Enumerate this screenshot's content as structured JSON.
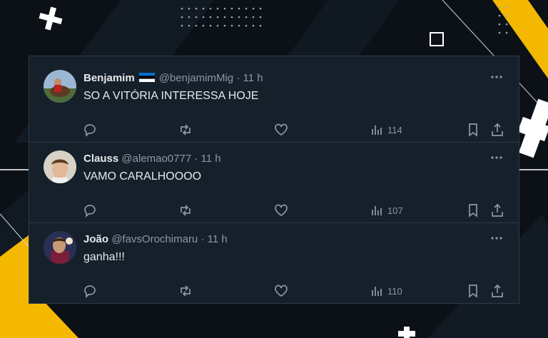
{
  "colors": {
    "panel_bg": "#15202b",
    "divider": "#2f3a46",
    "text": "#e7e9ea",
    "muted": "#8b98a5",
    "accent": "#f5b800"
  },
  "icons": [
    "reply-icon",
    "retweet-icon",
    "like-icon",
    "views-icon",
    "bookmark-icon",
    "share-icon",
    "more-icon",
    "flag-estonia-icon"
  ],
  "tweets": [
    {
      "name": "Benjamim",
      "handle": "@benjamimMig",
      "sep": "·",
      "time": "11 h",
      "text": "SO A VITÓRIA INTERESSA HOJE",
      "views": "114",
      "flag": "flag-estonia-icon"
    },
    {
      "name": "Clauss",
      "handle": "@alemao0777",
      "sep": "·",
      "time": "11 h",
      "text": "VAMO CARALHOOOO",
      "views": "107"
    },
    {
      "name": "João",
      "handle": "@favsOrochimaru",
      "sep": "·",
      "time": "11 h",
      "text": "ganha!!!",
      "views": "110"
    }
  ]
}
